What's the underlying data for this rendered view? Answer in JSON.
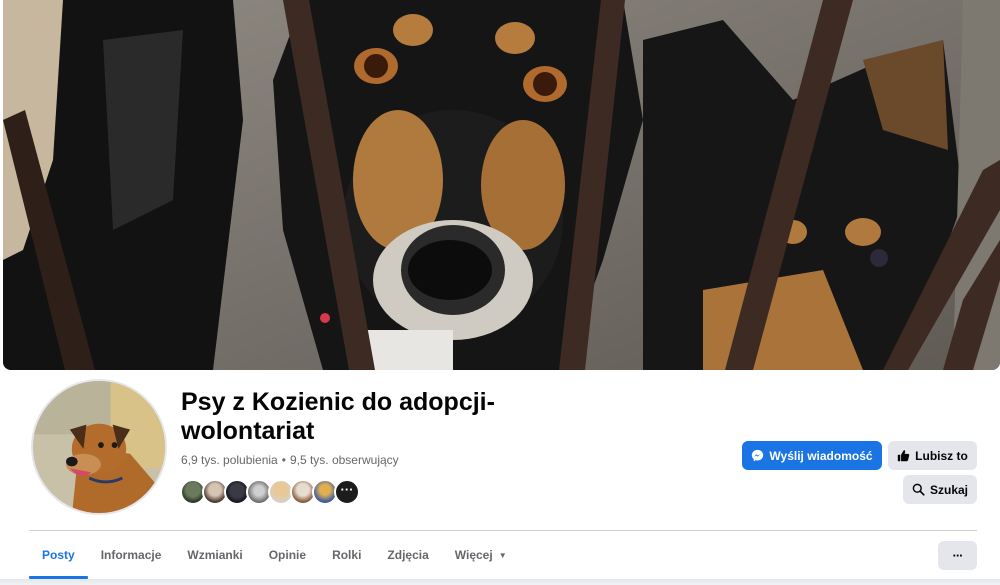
{
  "page": {
    "title": "Psy z Kozienic do adopcji-wolontariat",
    "likes": "6,9 tys. polubienia",
    "separator": "•",
    "followers": "9,5 tys. obserwujący"
  },
  "actions": {
    "message_label": "Wyślij wiadomość",
    "like_label": "Lubisz to",
    "search_label": "Szukaj",
    "more_label": "···"
  },
  "friends": {
    "more_label": "···"
  },
  "tabs": [
    {
      "label": "Posty",
      "active": true
    },
    {
      "label": "Informacje"
    },
    {
      "label": "Wzmianki"
    },
    {
      "label": "Opinie"
    },
    {
      "label": "Rolki"
    },
    {
      "label": "Zdjęcia"
    },
    {
      "label": "Więcej",
      "dropdown": true
    }
  ],
  "colors": {
    "accent": "#1b74e4",
    "secondary_button": "#e4e6eb",
    "muted_text": "#65676b"
  },
  "icons": {
    "message": "messenger-icon",
    "like": "thumbs-up-icon",
    "search": "search-icon",
    "dropdown": "caret-down-icon"
  }
}
